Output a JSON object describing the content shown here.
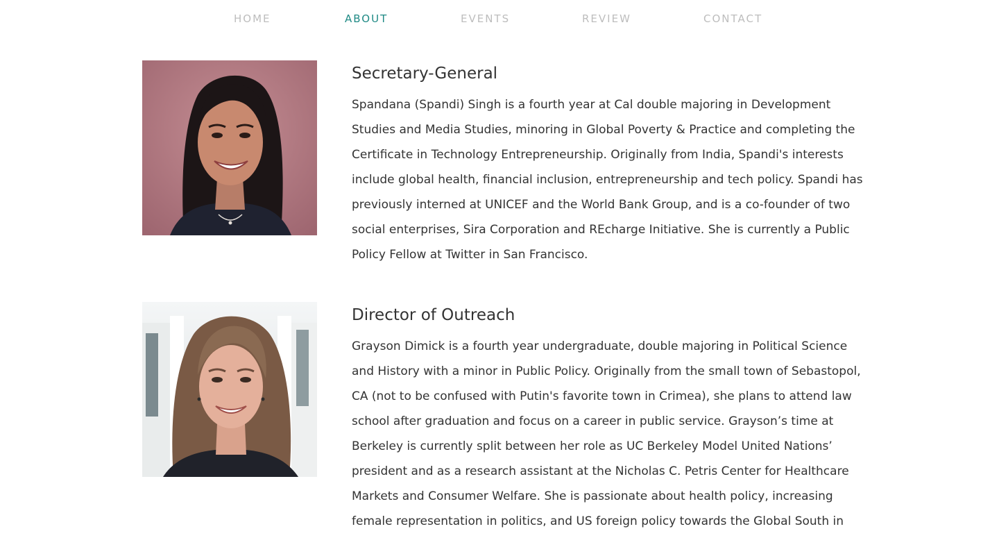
{
  "nav": {
    "items": [
      {
        "label": "HOME",
        "active": false
      },
      {
        "label": "ABOUT",
        "active": true
      },
      {
        "label": "EVENTS",
        "active": false
      },
      {
        "label": "REVIEW",
        "active": false
      },
      {
        "label": "CONTACT",
        "active": false
      }
    ],
    "active_color": "#1f8a85",
    "inactive_color": "#bdbdbd"
  },
  "members": [
    {
      "role": "Secretary-General",
      "bio": "Spandana (Spandi) Singh is a fourth year at Cal double majoring in Development Studies and Media Studies, minoring in Global Poverty & Practice and completing the Certificate in Technology Entrepreneurship. Originally from India, Spandi's interests include global health, financial inclusion, entrepreneurship and tech policy. Spandi has previously interned at UNICEF and the World Bank Group, and is a co-founder of two social enterprises, Sira Corporation and REcharge Initiative. She is currently a Public Policy Fellow at Twitter in San Francisco."
    },
    {
      "role": "Director of Outreach",
      "bio": "Grayson Dimick is a fourth year undergraduate, double majoring in Political Science and History with a minor in Public Policy. Originally from the small town of Sebastopol, CA (not to be confused with Putin's favorite town in Crimea), she plans to attend law school after graduation and focus on a career in public service. Grayson’s time at Berkeley is currently split between her role as UC Berkeley Model United Nations’ president and as a research assistant at the Nicholas C. Petris Center for Healthcare Markets and Consumer Welfare. She is passionate about health policy, increasing female representation in politics, and US foreign policy towards the Global South in"
    }
  ]
}
